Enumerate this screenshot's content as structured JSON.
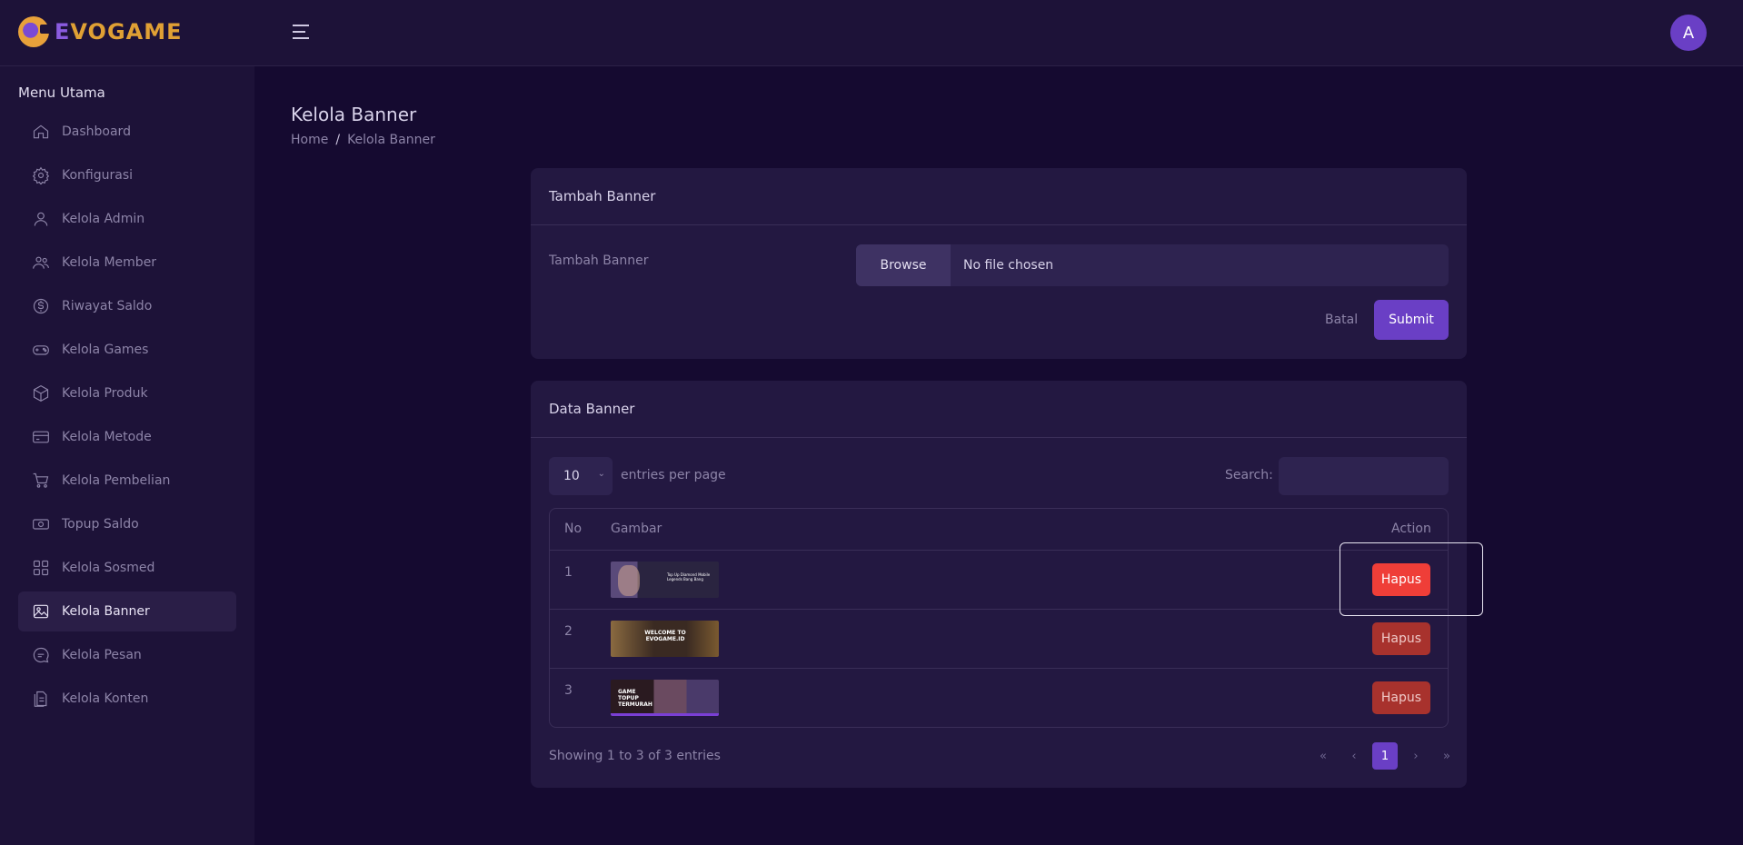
{
  "brand": {
    "name_first": "E",
    "name_rest": "VOGAME"
  },
  "header": {
    "avatar_initial": "A"
  },
  "sidebar": {
    "title": "Menu Utama",
    "items": [
      {
        "label": "Dashboard",
        "icon": "home-icon"
      },
      {
        "label": "Konfigurasi",
        "icon": "gear-icon"
      },
      {
        "label": "Kelola Admin",
        "icon": "user-icon"
      },
      {
        "label": "Kelola Member",
        "icon": "users-icon"
      },
      {
        "label": "Riwayat Saldo",
        "icon": "dollar-circle-icon"
      },
      {
        "label": "Kelola Games",
        "icon": "gamepad-icon"
      },
      {
        "label": "Kelola Produk",
        "icon": "box-icon"
      },
      {
        "label": "Kelola Metode",
        "icon": "card-icon"
      },
      {
        "label": "Kelola Pembelian",
        "icon": "cart-icon"
      },
      {
        "label": "Topup Saldo",
        "icon": "money-icon"
      },
      {
        "label": "Kelola Sosmed",
        "icon": "grid-icon"
      },
      {
        "label": "Kelola Banner",
        "icon": "image-icon"
      },
      {
        "label": "Kelola Pesan",
        "icon": "chat-icon"
      },
      {
        "label": "Kelola Konten",
        "icon": "document-icon"
      }
    ],
    "active": "Kelola Banner"
  },
  "page": {
    "title": "Kelola Banner",
    "breadcrumb": {
      "home": "Home",
      "sep": "/",
      "current": "Kelola Banner"
    }
  },
  "add_card": {
    "title": "Tambah Banner",
    "field_label": "Tambah Banner",
    "browse_label": "Browse",
    "file_status": "No file chosen",
    "cancel_label": "Batal",
    "submit_label": "Submit"
  },
  "data_card": {
    "title": "Data Banner",
    "entries_value": "10",
    "entries_label": "entries per page",
    "search_label": "Search:",
    "search_value": "",
    "columns": {
      "no": "No",
      "image": "Gambar",
      "action": "Action"
    },
    "rows": [
      {
        "no": "1",
        "delete_label": "Hapus",
        "thumb_text": "Top Up Diamond Mobile Legends Bang Bang",
        "thumb_colors": [
          "#2a2440",
          "#4a3a5e"
        ]
      },
      {
        "no": "2",
        "delete_label": "Hapus",
        "thumb_text": "WELCOME TO EVOGAME.ID",
        "thumb_colors": [
          "#3a2a22",
          "#8a5a30"
        ]
      },
      {
        "no": "3",
        "delete_label": "Hapus",
        "thumb_text": "GAME TOPUP TERMURAH",
        "thumb_colors": [
          "#2a1a20",
          "#6a4a60"
        ]
      }
    ],
    "showing": "Showing 1 to 3 of 3 entries",
    "pager": {
      "first": "«",
      "prev": "‹",
      "current": "1",
      "next": "›",
      "last": "»"
    }
  },
  "colors": {
    "accent": "#6a3fc5",
    "danger": "#ef3e38",
    "danger_muted": "#a8322d",
    "bg": "#150a30",
    "panel": "#231841"
  }
}
